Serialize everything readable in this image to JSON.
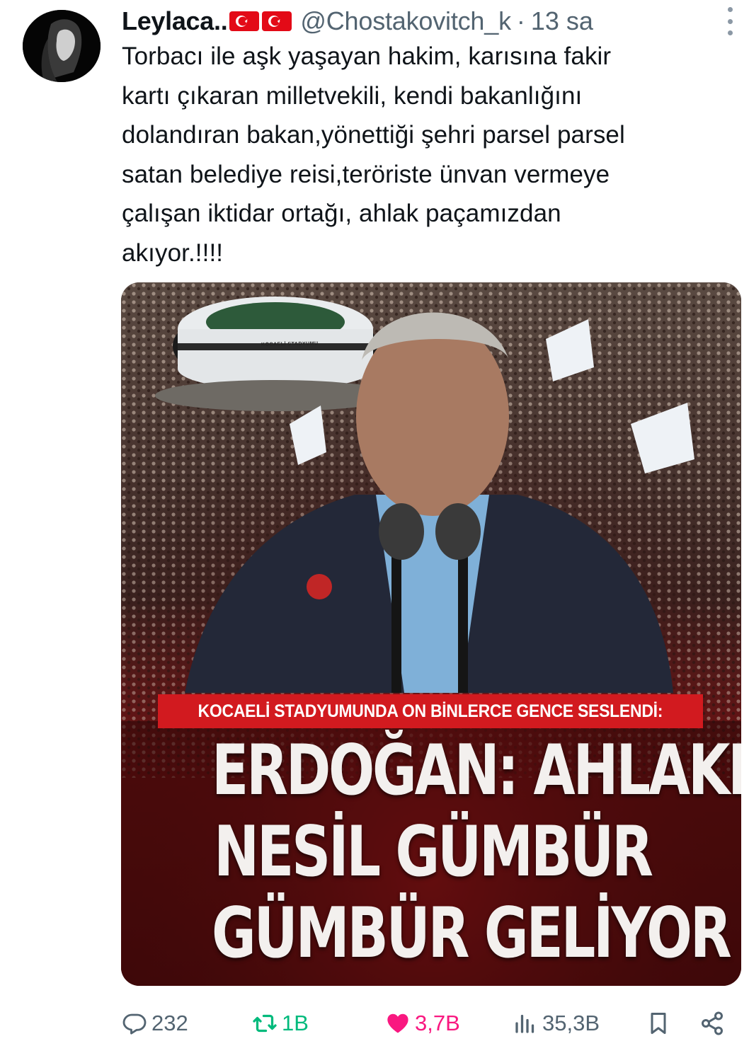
{
  "author": {
    "display_name": "Leylaca..",
    "flags": [
      "turkey-flag",
      "turkey-flag"
    ],
    "handle": "@Chostakovitch_k",
    "separator": "·",
    "time": "13 sa"
  },
  "tweet": {
    "text": "Torbacı ile aşk yaşayan hakim, karısına fakir\nkartı çıkaran milletvekili, kendi bakanlığını\ndolandıran bakan,yönettiği şehri parsel parsel\nsatan belediye reisi,teröriste ünvan vermeye\nçalışan iktidar ortağı, ahlak paçamızdan\nakıyor.!!!!"
  },
  "media": {
    "stadium_label": "KOCAELİ STADYUMU",
    "subhead": "KOCAELİ STADYUMUNDA ON BİNLERCE GENCE SESLENDİ:",
    "headline": [
      "ERDOĞAN: AHLAKLI",
      "NESİL GÜMBÜR",
      "GÜMBÜR GELİYOR"
    ]
  },
  "actions": {
    "reply": {
      "icon": "reply-icon",
      "count": "232"
    },
    "retweet": {
      "icon": "retweet-icon",
      "count": "1B"
    },
    "like": {
      "icon": "heart-icon",
      "count": "3,7B"
    },
    "views": {
      "icon": "views-icon",
      "count": "35,3B"
    },
    "bookmark": {
      "icon": "bookmark-icon"
    },
    "share": {
      "icon": "share-icon"
    }
  },
  "colors": {
    "text": "#0f1419",
    "secondary": "#536471",
    "retweet": "#00ba7c",
    "like": "#f91880",
    "flag_red": "#e30a17",
    "banner_red": "#d21a1f"
  }
}
